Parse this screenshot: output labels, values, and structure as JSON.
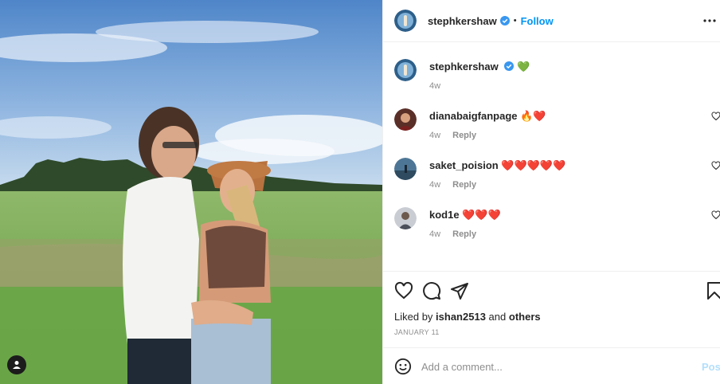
{
  "post": {
    "author": "stephkershaw",
    "follow_label": "Follow",
    "separator": "•",
    "caption_emoji": "💚",
    "caption_time": "4w",
    "liked_by_prefix": "Liked by",
    "liked_by_user": "ishan2513",
    "liked_by_and": "and",
    "liked_by_others": "others",
    "date": "JANUARY 11"
  },
  "comments": [
    {
      "user": "dianabaigfanpage",
      "text": "🔥❤️",
      "time": "4w",
      "reply": "Reply"
    },
    {
      "user": "saket_poision",
      "text": "❤️❤️❤️❤️❤️",
      "time": "4w",
      "reply": "Reply"
    },
    {
      "user": "kod1e",
      "text": "❤️❤️❤️",
      "time": "4w",
      "reply": "Reply"
    }
  ],
  "add_comment": {
    "placeholder": "Add a comment...",
    "post_label": "Post"
  },
  "icons": {
    "more": "more-options-icon",
    "verified": "verified-badge-icon",
    "like": "heart-icon",
    "comment": "comment-icon",
    "share": "share-icon",
    "save": "bookmark-icon",
    "emoji": "emoji-icon",
    "tags": "user-tag-icon"
  },
  "colors": {
    "accent": "#0095f6",
    "verified": "#3897f0",
    "muted": "#8e8e8e",
    "post_disabled": "#b2dffc"
  }
}
